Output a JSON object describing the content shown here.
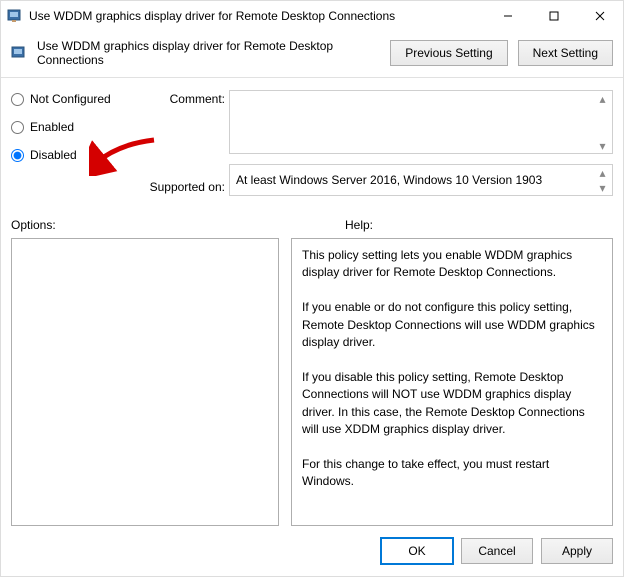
{
  "titlebar": {
    "title": "Use WDDM graphics display driver for Remote Desktop Connections"
  },
  "header": {
    "text": "Use WDDM graphics display driver for Remote Desktop Connections",
    "prev_button": "Previous Setting",
    "next_button": "Next Setting"
  },
  "radios": {
    "not_configured": "Not Configured",
    "enabled": "Enabled",
    "disabled": "Disabled",
    "selected": "disabled"
  },
  "labels": {
    "comment": "Comment:",
    "supported_on": "Supported on:",
    "options": "Options:",
    "help": "Help:"
  },
  "fields": {
    "comment_value": "",
    "supported_on_value": "At least Windows Server 2016, Windows 10 Version 1903"
  },
  "help_text": "This policy setting lets you enable WDDM graphics display driver for Remote Desktop Connections.\n\nIf you enable or do not configure this policy setting, Remote Desktop Connections will use WDDM graphics display driver.\n\nIf you disable this policy setting, Remote Desktop Connections will NOT use WDDM graphics display driver. In this case, the Remote Desktop Connections will use XDDM graphics display driver.\n\nFor this change to take effect, you must restart Windows.",
  "footer": {
    "ok": "OK",
    "cancel": "Cancel",
    "apply": "Apply"
  }
}
